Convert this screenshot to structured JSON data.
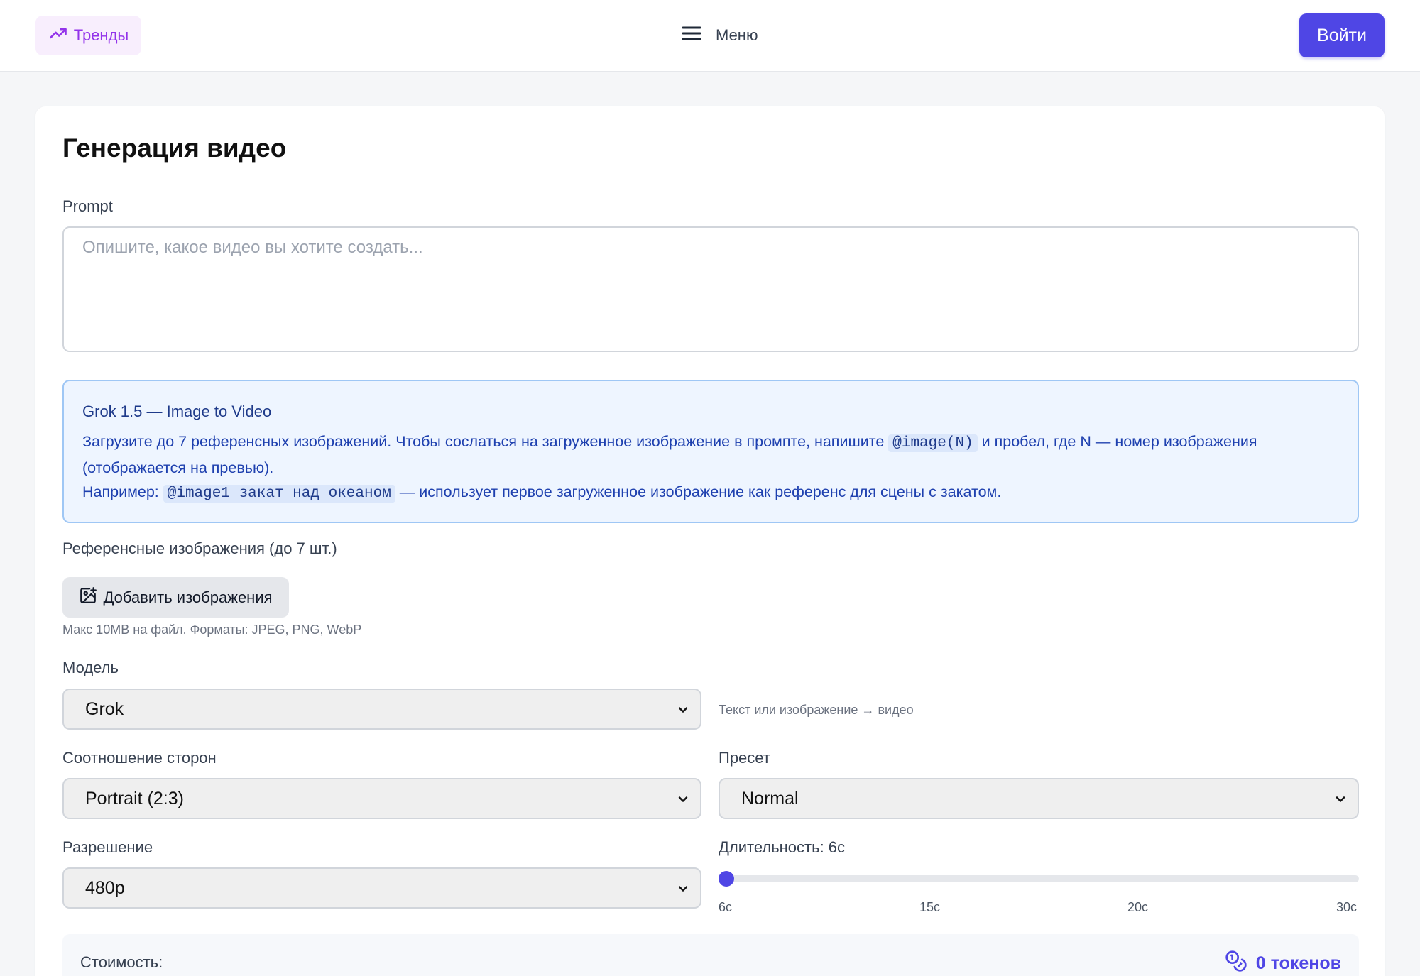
{
  "header": {
    "trends_label": "Тренды",
    "menu_label": "Меню",
    "login_label": "Войти"
  },
  "page": {
    "title": "Генерация видео"
  },
  "prompt": {
    "label": "Prompt",
    "placeholder": "Опишите, какое видео вы хотите создать...",
    "value": ""
  },
  "info": {
    "title": "Grok 1.5 — Image to Video",
    "line1_before": "Загрузите до 7 референсных изображений. Чтобы сослаться на загруженное изображение в промпте, напишите ",
    "line1_code": "@image(N)",
    "line1_after": " и пробел, где N — номер изображения (отображается на превью).",
    "line2_before": "Например: ",
    "line2_code": "@image1 закат над океаном",
    "line2_after": " — использует первое загруженное изображение как референс для сцены с закатом."
  },
  "references": {
    "label": "Референсные изображения (до 7 шт.)",
    "add_button_label": "Добавить изображения",
    "hint": "Макс 10MB на файл. Форматы: JPEG, PNG, WebP"
  },
  "model": {
    "label": "Модель",
    "selected": "Grok",
    "hint": "Текст или изображение → видео"
  },
  "aspect": {
    "label": "Соотношение сторон",
    "selected": "Portrait (2:3)"
  },
  "preset": {
    "label": "Пресет",
    "selected": "Normal"
  },
  "resolution": {
    "label": "Разрешение",
    "selected": "480p"
  },
  "duration": {
    "label": "Длительность: 6с",
    "value_seconds": 6,
    "min_seconds": 6,
    "max_seconds": 30,
    "ticks": [
      "6с",
      "15с",
      "20с",
      "30с"
    ]
  },
  "cost": {
    "label": "Стоимость:",
    "value": "0 токенов"
  },
  "colors": {
    "accent": "#4f46e5",
    "trends_bg": "#f8eefd",
    "trends_text": "#9333ea",
    "info_bg": "#eef5ff",
    "info_border": "#9fc7f5",
    "info_text": "#1e40af"
  },
  "icons": {
    "trends": "trending-up-icon",
    "menu": "hamburger-menu-icon",
    "add_image": "image-plus-icon",
    "chevron": "chevron-down-icon",
    "coins": "coins-icon"
  }
}
